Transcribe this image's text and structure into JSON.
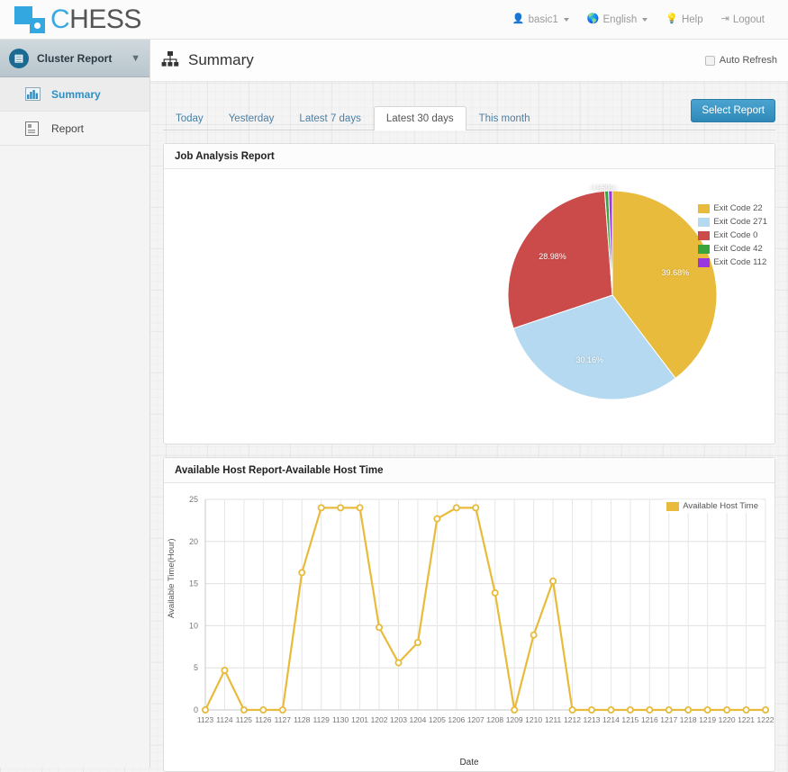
{
  "app": {
    "logo_c": "C",
    "logo_rest": "HESS",
    "logo_icon": "chess-logo-icon"
  },
  "topnav": [
    {
      "label": "basic1",
      "icon": "user-icon",
      "caret": true
    },
    {
      "label": "English",
      "icon": "globe-icon",
      "caret": true
    },
    {
      "label": "Help",
      "icon": "lightbulb-icon",
      "caret": false
    },
    {
      "label": "Logout",
      "icon": "logout-icon",
      "caret": false
    }
  ],
  "sidebar": {
    "header": {
      "label": "Cluster Report",
      "icon": "report-module-icon",
      "chevron": "⌄"
    },
    "items": [
      {
        "label": "Summary",
        "icon": "bar-chart-icon",
        "active": true
      },
      {
        "label": "Report",
        "icon": "document-icon",
        "active": false
      }
    ]
  },
  "page": {
    "title": "Summary",
    "title_icon": "sitemap-icon",
    "auto_refresh_label": "Auto Refresh",
    "auto_refresh_checked": false
  },
  "tabs": [
    {
      "label": "Today",
      "active": false
    },
    {
      "label": "Yesterday",
      "active": false
    },
    {
      "label": "Latest 7 days",
      "active": false
    },
    {
      "label": "Latest 30 days",
      "active": true
    },
    {
      "label": "This month",
      "active": false
    }
  ],
  "select_report_button": "Select Report",
  "panels": {
    "pie_title": "Job Analysis Report",
    "line_title": "Available Host Report-Available Host Time"
  },
  "colors": {
    "gold": "#e8bb3c",
    "lightblue": "#b4d9f0",
    "red": "#cb4b4b",
    "green": "#39a33c",
    "purple": "#9a37e0",
    "accent": "#2f8ab9",
    "sidebar_active_text": "#2f8fc4"
  },
  "chart_data": [
    {
      "type": "pie",
      "title": "Job Analysis Report",
      "legend_position": "right",
      "labels": [
        "Exit Code 22",
        "Exit Code 271",
        "Exit Code 0",
        "Exit Code 42",
        "Exit Code 112"
      ],
      "values": [
        39.68,
        30.16,
        28.98,
        0.59,
        0.59
      ],
      "value_labels": [
        "39.68%",
        "30.16%",
        "28.98%",
        "0.59%",
        "0.59%"
      ],
      "colors": [
        "#e8bb3c",
        "#b4d9f0",
        "#cb4b4b",
        "#39a33c",
        "#9a37e0"
      ]
    },
    {
      "type": "line",
      "title": "Available Host Report-Available Host Time",
      "series_name": "Available Host Time",
      "color": "#e8bb3c",
      "xlabel": "Date",
      "ylabel": "Available Time(Hour)",
      "ylim": [
        0,
        25
      ],
      "yticks": [
        0,
        5,
        10,
        15,
        20,
        25
      ],
      "grid": true,
      "legend_position": "top-right",
      "categories": [
        "1123",
        "1124",
        "1125",
        "1126",
        "1127",
        "1128",
        "1129",
        "1130",
        "1201",
        "1202",
        "1203",
        "1204",
        "1205",
        "1206",
        "1207",
        "1208",
        "1209",
        "1210",
        "1211",
        "1212",
        "1213",
        "1214",
        "1215",
        "1216",
        "1217",
        "1218",
        "1219",
        "1220",
        "1221",
        "1222"
      ],
      "values": [
        0,
        4.7,
        0,
        0,
        0,
        16.3,
        24,
        24,
        24,
        9.8,
        5.6,
        8.0,
        22.7,
        24,
        24,
        13.9,
        0,
        8.9,
        15.3,
        0,
        0,
        0,
        0,
        0,
        0,
        0,
        0,
        0,
        0,
        0
      ]
    }
  ]
}
